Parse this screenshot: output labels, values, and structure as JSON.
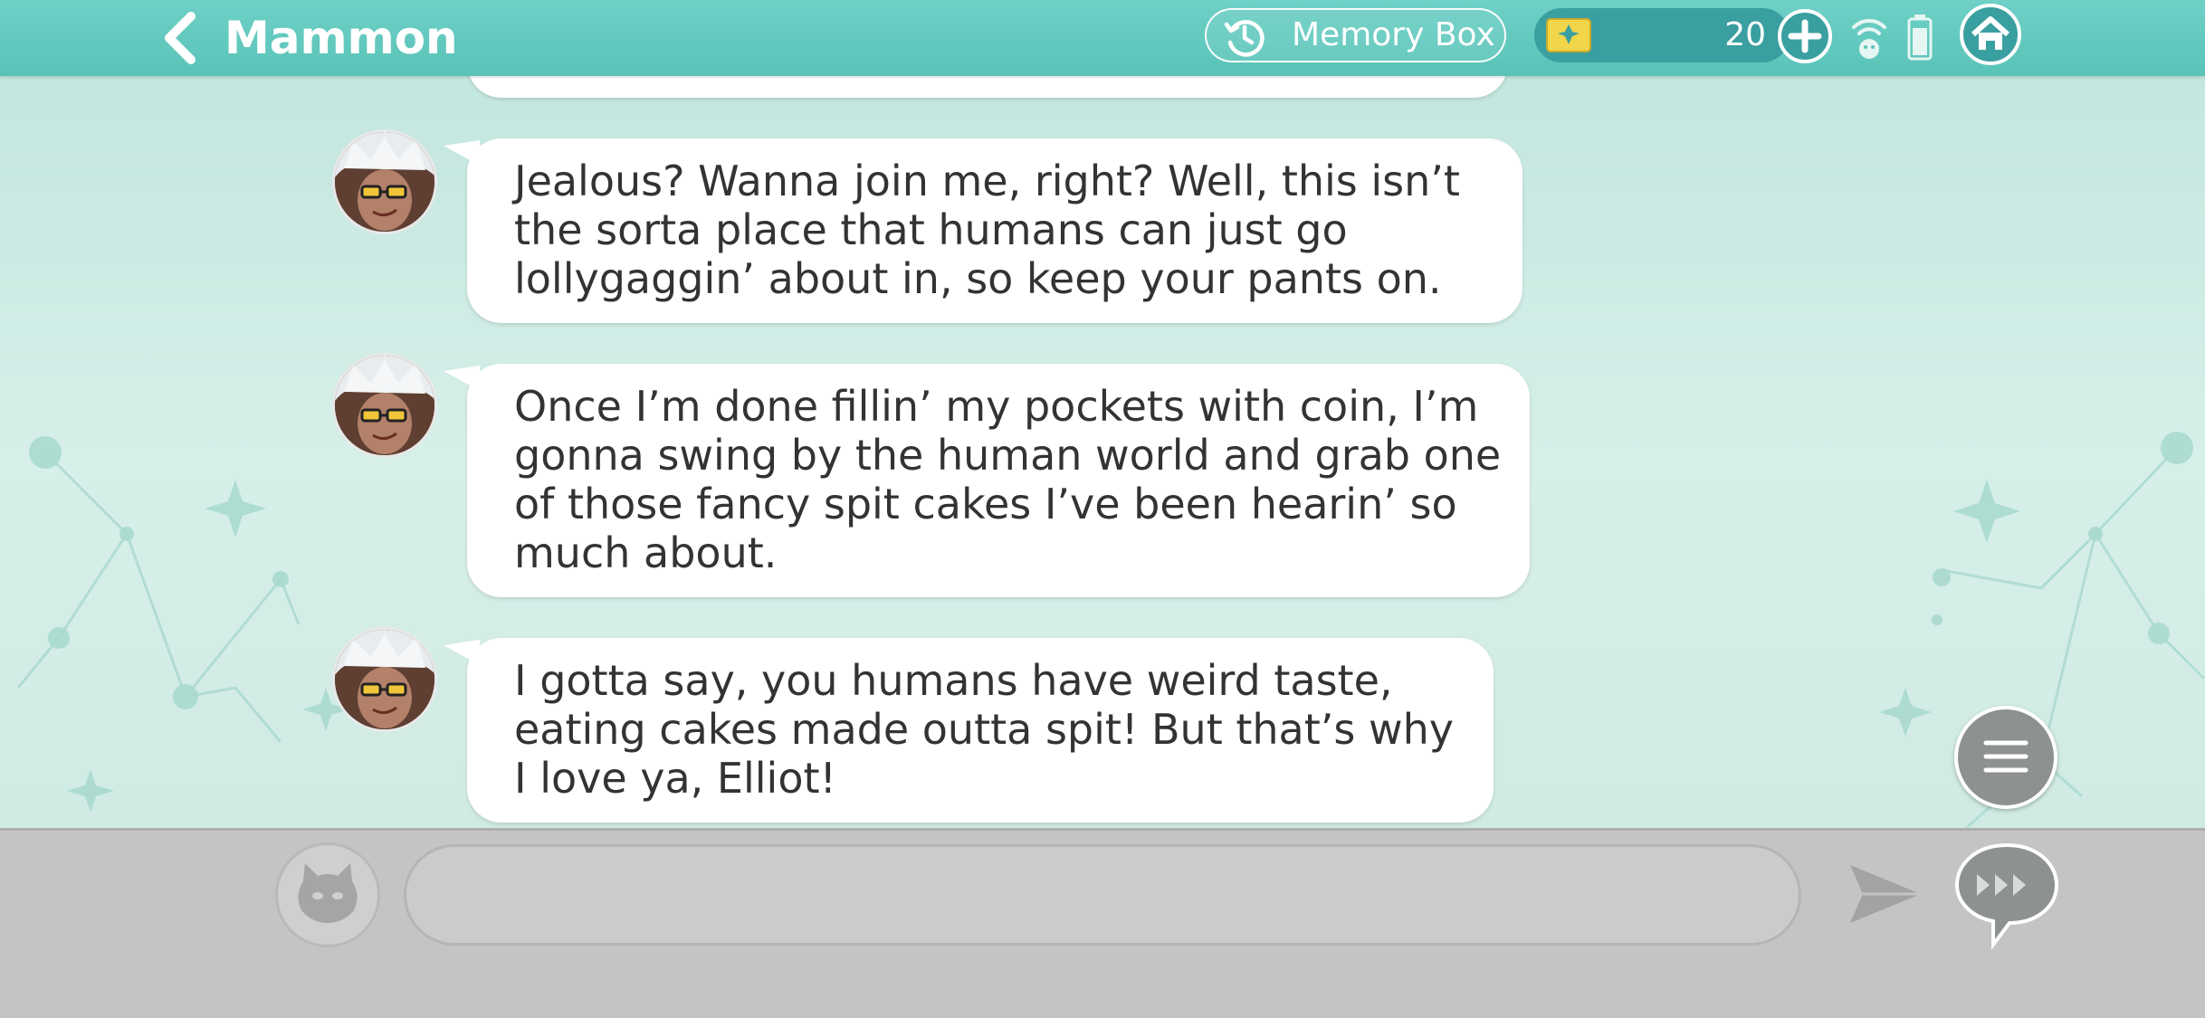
{
  "header": {
    "title": "Mammon",
    "memory_box_label": "Memory Box",
    "currency_count": "20"
  },
  "messages": [
    {
      "sender": "Mammon",
      "text": "Jealous? Wanna join me, right? Well, this isn’t the sorta place that humans can just go lollygaggin’ about in, so keep your pants on."
    },
    {
      "sender": "Mammon",
      "text": "Once I’m done fillin’ my pockets with coin, I’m gonna swing by the human world and grab one of those fancy spit cakes I’ve been hearin’ so much about."
    },
    {
      "sender": "Mammon",
      "text": "I gotta say, you humans have weird taste, eating cakes made outta spit! But that’s why I love ya, Elliot!"
    }
  ],
  "input": {
    "value": "",
    "placeholder": ""
  },
  "icons": {
    "back": "chevron-left-icon",
    "memory_box": "history-clock-icon",
    "currency": "gem-icon",
    "add": "plus-icon",
    "signal": "wifi-icon",
    "battery": "battery-icon",
    "home": "home-icon",
    "menu": "hamburger-menu-icon",
    "stamp": "devil-face-icon",
    "send": "send-arrow-icon",
    "skip": "fast-forward-bubble-icon"
  },
  "colors": {
    "header": "#5fc8bd",
    "background": "#d3ede7",
    "currency_pill": "#3a9fa0",
    "bubble": "#ffffff",
    "bottom_bar": "#c4c4c4"
  }
}
